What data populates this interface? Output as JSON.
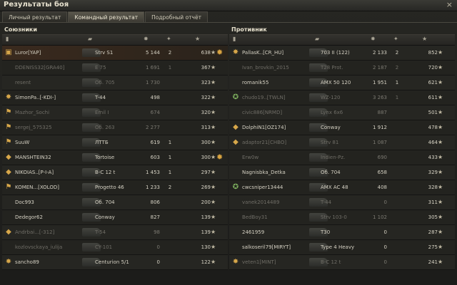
{
  "window": {
    "title": "Результаты боя",
    "close_glyph": "×"
  },
  "tabs": [
    {
      "label": "Личный результат"
    },
    {
      "label": "Командный результат"
    },
    {
      "label": "Подробный отчёт"
    }
  ],
  "left": {
    "title": "Союзники",
    "rows": [
      {
        "player": "Luror[YAP]",
        "tank": "Strv S1",
        "damage": "5 144",
        "kills": "2",
        "xp": "638",
        "medal": true,
        "state": "alive",
        "icon": "tank-icon"
      },
      {
        "player": "DDENISS32[GRA40]",
        "tank": "E 75",
        "damage": "1 691",
        "kills": "1",
        "xp": "367",
        "state": "dead",
        "icon": ""
      },
      {
        "player": "resent",
        "tank": "Об. 705",
        "damage": "1 730",
        "kills": "",
        "xp": "323",
        "state": "dead",
        "icon": ""
      },
      {
        "player": "SimonPa..[-KDI-]",
        "tank": "T-44",
        "damage": "498",
        "kills": "",
        "xp": "322",
        "state": "alive",
        "icon": "star-icon"
      },
      {
        "player": "Mazhor_Sochi",
        "tank": "Emil I",
        "damage": "674",
        "kills": "",
        "xp": "320",
        "state": "dead",
        "icon": "flag-icon"
      },
      {
        "player": "sergej_575325",
        "tank": "Об. 263",
        "damage": "2 277",
        "kills": "",
        "xp": "313",
        "state": "dead",
        "icon": "flag-icon"
      },
      {
        "player": "SuuW",
        "tank": "ЛТТБ",
        "damage": "619",
        "kills": "1",
        "xp": "300",
        "state": "alive",
        "icon": "flag-icon"
      },
      {
        "player": "MANSHTEIN32",
        "tank": "Tortoise",
        "damage": "603",
        "kills": "1",
        "xp": "300",
        "medal": true,
        "state": "alive",
        "icon": "diamond-icon"
      },
      {
        "player": "NIKOIAS..[P-I-A]",
        "tank": "B-C 12 t",
        "damage": "1 453",
        "kills": "1",
        "xp": "297",
        "state": "alive",
        "icon": "diamond-icon"
      },
      {
        "player": "KOMEN...[XOLOD]",
        "tank": "Progetto 46",
        "damage": "1 233",
        "kills": "2",
        "xp": "269",
        "state": "alive",
        "icon": "flag-icon"
      },
      {
        "player": "Doc993",
        "tank": "Об. 704",
        "damage": "806",
        "kills": "",
        "xp": "200",
        "state": "alive",
        "icon": ""
      },
      {
        "player": "Dedegor62",
        "tank": "Conway",
        "damage": "827",
        "kills": "",
        "xp": "139",
        "state": "alive",
        "icon": ""
      },
      {
        "player": "Andrbai...[-312]",
        "tank": "T-54",
        "damage": "98",
        "kills": "",
        "xp": "139",
        "state": "dead",
        "icon": "diamond-icon"
      },
      {
        "player": "kozlovsckaya_iulija",
        "tank": "CY-101",
        "damage": "0",
        "kills": "",
        "xp": "130",
        "state": "dead",
        "icon": ""
      },
      {
        "player": "sancho89",
        "tank": "Centurion 5/1",
        "damage": "0",
        "kills": "",
        "xp": "122",
        "state": "alive",
        "icon": "star-icon"
      }
    ]
  },
  "right": {
    "title": "Противник",
    "rows": [
      {
        "player": "PallasK..[CR_HU]",
        "tank": "703 II (122)",
        "damage": "2 133",
        "kills": "2",
        "xp": "852",
        "state": "alive",
        "icon": "star-icon"
      },
      {
        "player": "Ivan_brovkin_2015",
        "tank": "T28 Prot.",
        "damage": "2 187",
        "kills": "2",
        "xp": "720",
        "state": "dead",
        "icon": ""
      },
      {
        "player": "romanik55",
        "tank": "AMX 50 120",
        "damage": "1 951",
        "kills": "1",
        "xp": "621",
        "state": "alive",
        "icon": ""
      },
      {
        "player": "chudo19..[TWLN]",
        "tank": "WZ-120",
        "damage": "3 263",
        "kills": "1",
        "xp": "611",
        "state": "dead",
        "icon": "medal-icon"
      },
      {
        "player": "civic886[NRMD]",
        "tank": "Lynx 6x6",
        "damage": "887",
        "kills": "",
        "xp": "501",
        "state": "dead",
        "icon": ""
      },
      {
        "player": "DolphiN1[OZ174]",
        "tank": "Conway",
        "damage": "1 912",
        "kills": "",
        "xp": "478",
        "state": "alive",
        "icon": "diamond-icon"
      },
      {
        "player": "adaptor21[CHBO]",
        "tank": "Strv 81",
        "damage": "1 087",
        "kills": "",
        "xp": "464",
        "state": "dead",
        "icon": "diamond-icon"
      },
      {
        "player": "Erw0w",
        "tank": "Indien-Pz.",
        "damage": "690",
        "kills": "",
        "xp": "433",
        "state": "dead",
        "icon": ""
      },
      {
        "player": "Nagnisbka_Detka",
        "tank": "Об. 704",
        "damage": "658",
        "kills": "",
        "xp": "329",
        "state": "alive",
        "icon": ""
      },
      {
        "player": "cwcsniper13444",
        "tank": "AMX AC 48",
        "damage": "408",
        "kills": "",
        "xp": "328",
        "state": "alive",
        "icon": "medal-icon"
      },
      {
        "player": "vanek2014489",
        "tank": "T-44",
        "damage": "0",
        "kills": "",
        "xp": "311",
        "state": "dead",
        "icon": ""
      },
      {
        "player": "BedBoy31",
        "tank": "Strv 103-0",
        "damage": "1 102",
        "kills": "",
        "xp": "305",
        "state": "dead",
        "icon": ""
      },
      {
        "player": "2461959",
        "tank": "T30",
        "damage": "0",
        "kills": "",
        "xp": "287",
        "state": "alive",
        "icon": ""
      },
      {
        "player": "salkoseril79[MIRYT]",
        "tank": "Type 4 Heavy",
        "damage": "0",
        "kills": "",
        "xp": "275",
        "state": "alive",
        "icon": ""
      },
      {
        "player": "veten1[MINT]",
        "tank": "B-C 12 t",
        "damage": "0",
        "kills": "",
        "xp": "241",
        "state": "dead",
        "icon": "star-icon"
      }
    ]
  },
  "colors": {
    "gold": "#d9a441",
    "text": "#c9c7bd",
    "dead": "#6f6d66"
  }
}
